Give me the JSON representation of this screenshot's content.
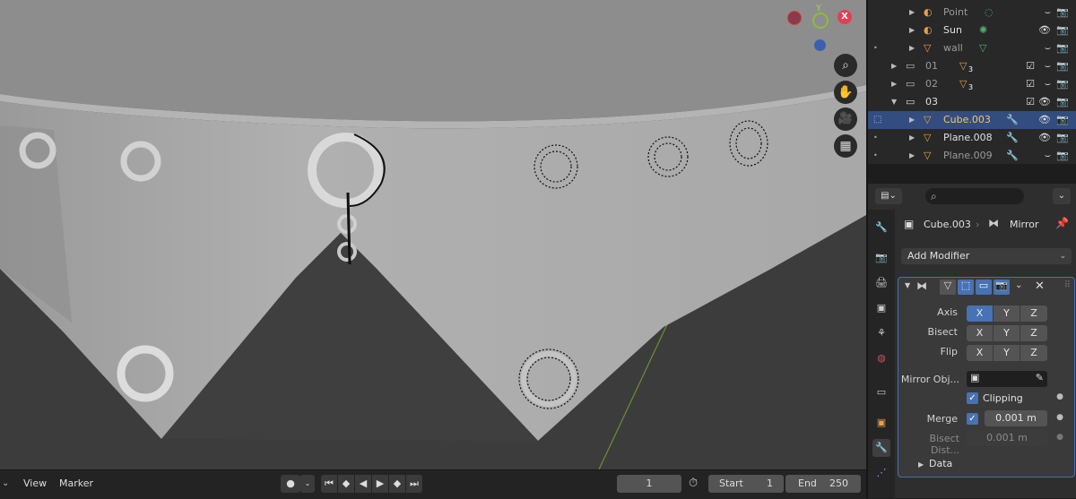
{
  "timeline": {
    "menu_view": "View",
    "menu_marker": "Marker",
    "current_frame": "1",
    "start_label": "Start",
    "start_value": "1",
    "end_label": "End",
    "end_value": "250"
  },
  "outliner": {
    "rows": [
      {
        "name": "Point"
      },
      {
        "name": "Sun"
      },
      {
        "name": "wall"
      },
      {
        "name": "01",
        "badge": "3"
      },
      {
        "name": "02",
        "badge": "3"
      },
      {
        "name": "03"
      },
      {
        "name": "Cube.003"
      },
      {
        "name": "Plane.008"
      },
      {
        "name": "Plane.009"
      }
    ]
  },
  "properties": {
    "search_placeholder": "",
    "breadcrumb_object": "Cube.003",
    "breadcrumb_modifier": "Mirror",
    "add_modifier": "Add Modifier",
    "axis_label": "Axis",
    "bisect_label": "Bisect",
    "flip_label": "Flip",
    "x": "X",
    "y": "Y",
    "z": "Z",
    "mirror_object_label": "Mirror Obj...",
    "clipping_label": "Clipping",
    "merge_label": "Merge",
    "merge_value": "0.001 m",
    "bisect_distance_label": "Bisect Dist...",
    "bisect_distance_value": "0.001 m",
    "data_label": "Data"
  },
  "gizmo": {
    "x_label": "X",
    "y_label": "Y"
  },
  "colors": {
    "selection": "#334d80",
    "active_button": "#4772b3",
    "object_orange": "#e8a04a"
  }
}
